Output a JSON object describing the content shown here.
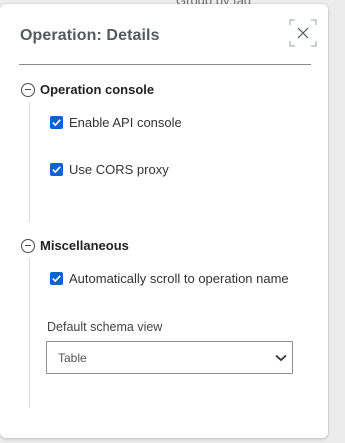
{
  "background": {
    "partial_text": "Group by tag"
  },
  "dialog": {
    "title": "Operation: Details",
    "close_icon": "close-expand-icon"
  },
  "sections": {
    "console": {
      "label": "Operation console",
      "icon": "collapse-minus-icon",
      "options": [
        {
          "label": "Enable API console",
          "checked": true
        },
        {
          "label": "Use CORS proxy",
          "checked": true
        }
      ]
    },
    "misc": {
      "label": "Miscellaneous",
      "icon": "collapse-minus-icon",
      "options": [
        {
          "label": "Automatically scroll to operation name",
          "checked": true
        }
      ],
      "schema_view": {
        "label": "Default schema view",
        "value": "Table"
      }
    }
  },
  "colors": {
    "accent": "#0a63d1",
    "title": "#555a60"
  }
}
